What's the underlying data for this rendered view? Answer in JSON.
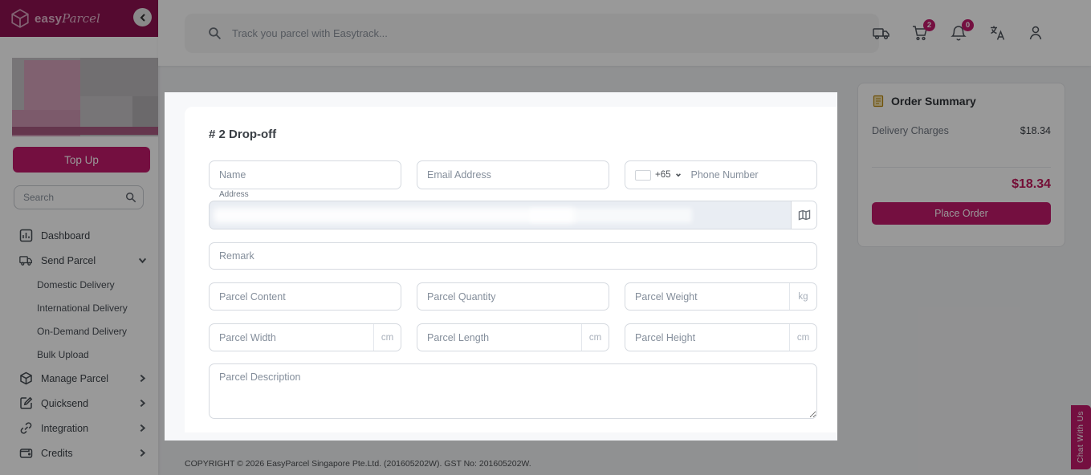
{
  "brand": {
    "accent": "#c2196b",
    "header_bg": "#8e1150",
    "total_color": "#c2185b"
  },
  "sidebar": {
    "logo": {
      "bold": "easy",
      "script": "Parcel"
    },
    "topup_label": "Top Up",
    "search_placeholder": "Search",
    "items": [
      {
        "label": "Dashboard",
        "icon": "bar-chart-icon"
      },
      {
        "label": "Send Parcel",
        "icon": "truck-icon",
        "chevron": "down",
        "expanded": true
      },
      {
        "label": "Manage Parcel",
        "icon": "box-icon",
        "chevron": "right"
      },
      {
        "label": "Quicksend",
        "icon": "edit-icon",
        "chevron": "right"
      },
      {
        "label": "Integration",
        "icon": "link-icon",
        "chevron": "right"
      },
      {
        "label": "Credits",
        "icon": "wallet-icon",
        "chevron": "right"
      }
    ],
    "send_parcel_subitems": [
      {
        "label": "Domestic Delivery"
      },
      {
        "label": "International Delivery"
      },
      {
        "label": "On-Demand Delivery"
      },
      {
        "label": "Bulk Upload"
      }
    ]
  },
  "topbar": {
    "search_placeholder": "Track you parcel with Easytrack...",
    "cart_badge": "2",
    "bell_badge": "0"
  },
  "modal": {
    "title": "# 2 Drop-off",
    "fields": {
      "name_placeholder": "Name",
      "email_placeholder": "Email Address",
      "phone_prefix": "+65",
      "phone_placeholder": "Phone Number",
      "address_label": "Address",
      "remark_placeholder": "Remark",
      "parcel_content_placeholder": "Parcel Content",
      "parcel_quantity_placeholder": "Parcel Quantity",
      "parcel_weight_placeholder": "Parcel Weight",
      "weight_unit": "kg",
      "parcel_width_placeholder": "Parcel Width",
      "parcel_length_placeholder": "Parcel Length",
      "parcel_height_placeholder": "Parcel Height",
      "dimension_unit": "cm",
      "parcel_description_placeholder": "Parcel Description"
    }
  },
  "order_summary": {
    "title": "Order Summary",
    "delivery_charges_label": "Delivery Charges",
    "delivery_charges_value": "$18.34",
    "total": "$18.34",
    "place_order_label": "Place Order"
  },
  "footer": {
    "copyright": "COPYRIGHT © 2026 EasyParcel Singapore Pte.Ltd. (201605202W). GST No: 201605202W."
  },
  "chat": {
    "label": "Chat With Us"
  }
}
